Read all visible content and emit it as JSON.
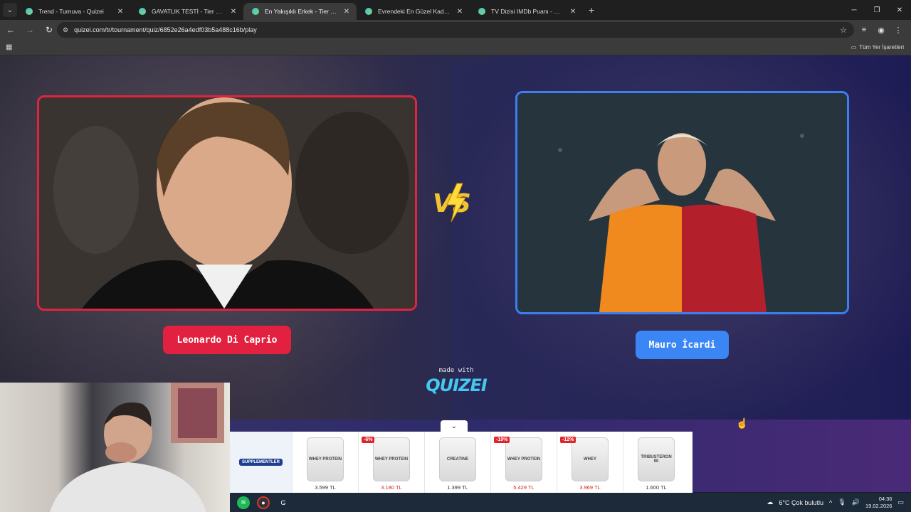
{
  "browser": {
    "tabs": [
      {
        "title": "Trend - Turnuva - Quizei",
        "active": false
      },
      {
        "title": "GAVATLIK TESTİ - Tier List | Kör",
        "active": false
      },
      {
        "title": "En Yakışıklı Erkek - Tier List, Kör",
        "active": true
      },
      {
        "title": "Evrendeki En Güzel Kadın (En G",
        "active": false
      },
      {
        "title": "TV Dizisi IMDb Puanı - Quizei",
        "active": false
      }
    ],
    "new_tab_label": "+",
    "url": "quizei.com/tr/tournament/quiz/6852e26a4edf03b5a488c16b/play",
    "bookmarks_label": "Tüm Yer İşaretleri"
  },
  "tournament": {
    "left_name": "Leonardo Di Caprio",
    "right_name": "Mauro İcardi",
    "vs_text": "VS",
    "accent_left": "#e2203f",
    "accent_right": "#3a86f5"
  },
  "branding": {
    "made_with": "made with",
    "logo": "QUIZEI"
  },
  "ad": {
    "brand": "SUPPLEMENTLER",
    "products": [
      {
        "label": "WHEY PROTEIN",
        "price": "3.599 TL",
        "discount": "",
        "sale": false
      },
      {
        "label": "WHEY PROTEIN",
        "price": "3.180 TL",
        "discount": "-6%",
        "sale": true
      },
      {
        "label": "CREATINE",
        "price": "1.399 TL",
        "discount": "",
        "sale": false
      },
      {
        "label": "WHEY PROTEIN",
        "price": "5.429 TL",
        "discount": "-19%",
        "sale": true
      },
      {
        "label": "WHEY",
        "price": "3.969 TL",
        "discount": "-12%",
        "sale": true
      },
      {
        "label": "TRIBUSTERON 90",
        "price": "1.600 TL",
        "discount": "",
        "sale": false
      }
    ]
  },
  "taskbar": {
    "weather": "6°C  Çok bulutlu",
    "time": "04:36",
    "date": "19.02.2026"
  }
}
